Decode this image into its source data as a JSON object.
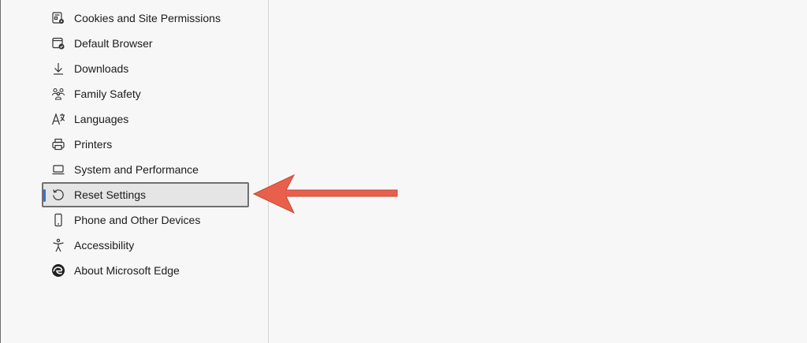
{
  "sidebar": {
    "items": [
      {
        "label": "Cookies and Site Permissions",
        "icon": "cookie-permissions-icon",
        "selected": false
      },
      {
        "label": "Default Browser",
        "icon": "default-browser-icon",
        "selected": false
      },
      {
        "label": "Downloads",
        "icon": "download-icon",
        "selected": false
      },
      {
        "label": "Family Safety",
        "icon": "family-icon",
        "selected": false
      },
      {
        "label": "Languages",
        "icon": "languages-icon",
        "selected": false
      },
      {
        "label": "Printers",
        "icon": "printer-icon",
        "selected": false
      },
      {
        "label": "System and Performance",
        "icon": "laptop-icon",
        "selected": false
      },
      {
        "label": "Reset Settings",
        "icon": "reset-icon",
        "selected": true
      },
      {
        "label": "Phone and Other Devices",
        "icon": "phone-icon",
        "selected": false
      },
      {
        "label": "Accessibility",
        "icon": "accessibility-icon",
        "selected": false
      },
      {
        "label": "About Microsoft Edge",
        "icon": "edge-logo-icon",
        "selected": false
      }
    ]
  },
  "colors": {
    "background": "#f7f7f7",
    "selected_background": "#e5e5e5",
    "selected_indicator": "#3a6fd0",
    "annotation_arrow": "#e8604c",
    "text": "#1b1b1b"
  }
}
